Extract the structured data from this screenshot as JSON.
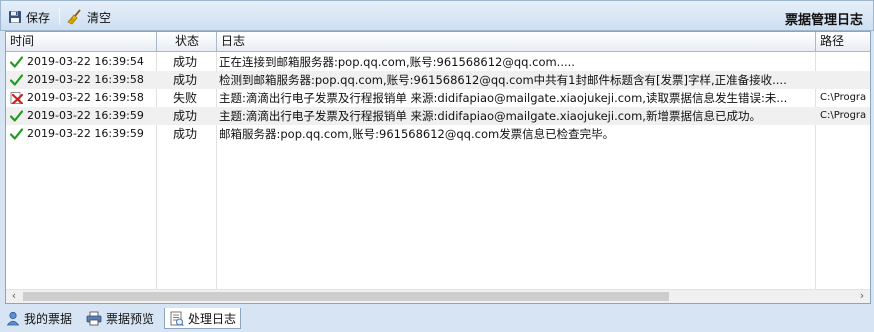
{
  "toolbar": {
    "save_label": "保存",
    "clear_label": "清空",
    "title": "票据管理日志"
  },
  "columns": {
    "time": "时间",
    "status": "状态",
    "log": "日志",
    "path": "路径"
  },
  "rows": [
    {
      "status_icon": "check-icon",
      "time": "2019-03-22 16:39:54",
      "status": "成功",
      "log": "正在连接到邮箱服务器:pop.qq.com,账号:961568612@qq.com.....",
      "path": ""
    },
    {
      "status_icon": "check-icon",
      "time": "2019-03-22 16:39:58",
      "status": "成功",
      "log": "检测到邮箱服务器:pop.qq.com,账号:961568612@qq.com中共有1封邮件标题含有[发票]字样,正准备接收....",
      "path": ""
    },
    {
      "status_icon": "error-icon",
      "time": "2019-03-22 16:39:58",
      "status": "失败",
      "log": "主题:滴滴出行电子发票及行程报销单 来源:didifapiao@mailgate.xiaojukeji.com,读取票据信息发生错误:未...",
      "path": "C:\\Progra"
    },
    {
      "status_icon": "check-icon",
      "time": "2019-03-22 16:39:59",
      "status": "成功",
      "log": "主题:滴滴出行电子发票及行程报销单 来源:didifapiao@mailgate.xiaojukeji.com,新增票据信息已成功。",
      "path": "C:\\Progra"
    },
    {
      "status_icon": "check-icon",
      "time": "2019-03-22 16:39:59",
      "status": "成功",
      "log": "邮箱服务器:pop.qq.com,账号:961568612@qq.com发票信息已检查完毕。",
      "path": ""
    }
  ],
  "tabs": [
    {
      "label": "我的票据",
      "icon": "person-icon",
      "active": false
    },
    {
      "label": "票据预览",
      "icon": "printer-icon",
      "active": false
    },
    {
      "label": "处理日志",
      "icon": "log-icon",
      "active": true
    }
  ],
  "colors": {
    "success": "#1f9a1f",
    "error": "#d02020",
    "alt_row": "#f0f0f0"
  }
}
